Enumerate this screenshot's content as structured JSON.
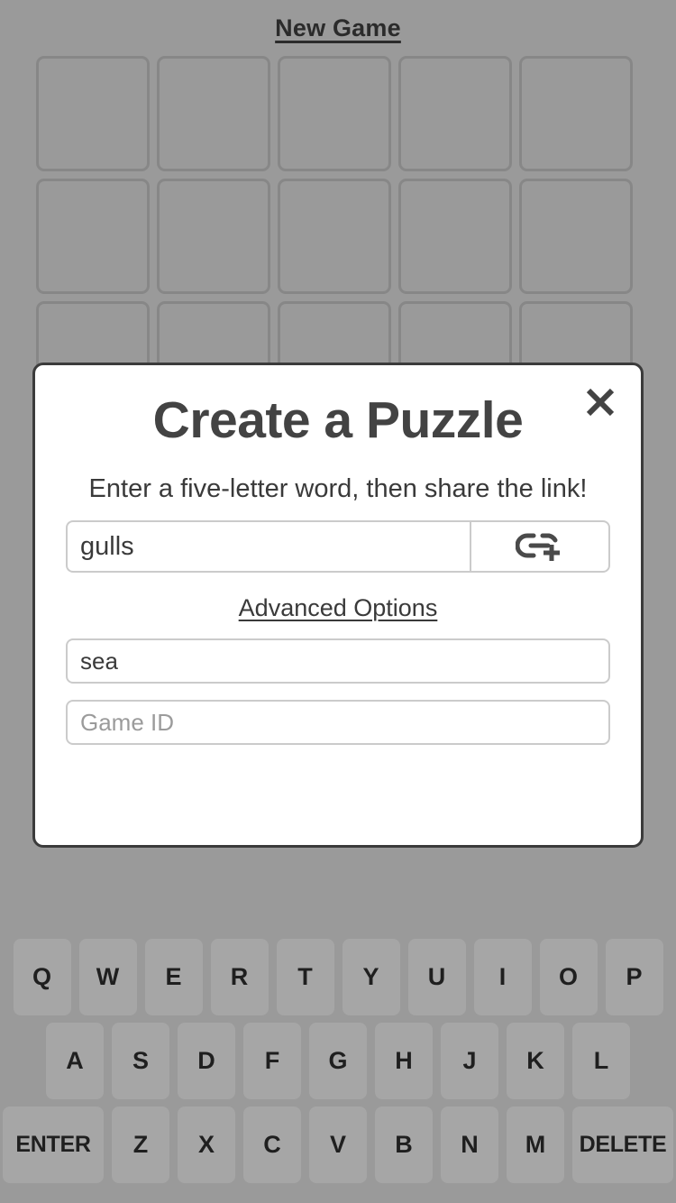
{
  "app": {
    "background_color": "#9a9a9a",
    "tile_border_color": "#878787",
    "key_color": "#a6a6a6",
    "text_color": "#2b2b2b"
  },
  "header": {
    "new_game_label": "New Game"
  },
  "board": {
    "rows": 3,
    "columns": 5,
    "tiles": [
      [
        "",
        "",
        "",
        "",
        ""
      ],
      [
        "",
        "",
        "",
        "",
        ""
      ],
      [
        "",
        "",
        "",
        "",
        ""
      ]
    ]
  },
  "keyboard": {
    "rows": [
      [
        {
          "label": "Q",
          "wide": false
        },
        {
          "label": "W",
          "wide": false
        },
        {
          "label": "E",
          "wide": false
        },
        {
          "label": "R",
          "wide": false
        },
        {
          "label": "T",
          "wide": false
        },
        {
          "label": "Y",
          "wide": false
        },
        {
          "label": "U",
          "wide": false
        },
        {
          "label": "I",
          "wide": false
        },
        {
          "label": "O",
          "wide": false
        },
        {
          "label": "P",
          "wide": false
        }
      ],
      [
        {
          "label": "A",
          "wide": false
        },
        {
          "label": "S",
          "wide": false
        },
        {
          "label": "D",
          "wide": false
        },
        {
          "label": "F",
          "wide": false
        },
        {
          "label": "G",
          "wide": false
        },
        {
          "label": "H",
          "wide": false
        },
        {
          "label": "J",
          "wide": false
        },
        {
          "label": "K",
          "wide": false
        },
        {
          "label": "L",
          "wide": false
        }
      ],
      [
        {
          "label": "ENTER",
          "wide": true
        },
        {
          "label": "Z",
          "wide": false
        },
        {
          "label": "X",
          "wide": false
        },
        {
          "label": "C",
          "wide": false
        },
        {
          "label": "V",
          "wide": false
        },
        {
          "label": "B",
          "wide": false
        },
        {
          "label": "N",
          "wide": false
        },
        {
          "label": "M",
          "wide": false
        },
        {
          "label": "DELETE",
          "wide": true
        }
      ]
    ]
  },
  "modal": {
    "title": "Create a Puzzle",
    "close_icon": "close-icon",
    "instruction": "Enter a five-letter word, then share the link!",
    "word_input": {
      "value": "gulls",
      "placeholder": ""
    },
    "create_link_button": {
      "icon": "add-link-icon"
    },
    "advanced_options": {
      "label": "Advanced Options",
      "hint_input": {
        "value": "sea",
        "placeholder": ""
      },
      "game_id_input": {
        "value": "",
        "placeholder": "Game ID"
      }
    }
  }
}
